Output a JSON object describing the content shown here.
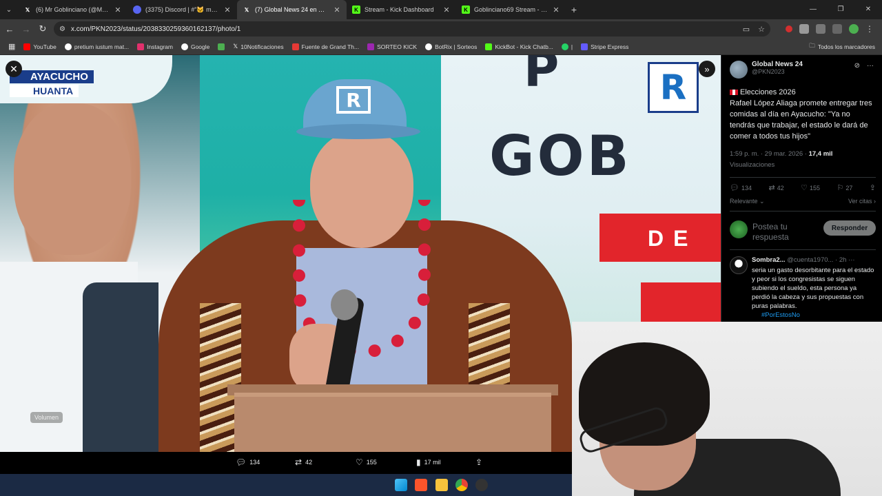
{
  "tabs": [
    {
      "title": "(6) Mr Goblinciano (@MGoblinciano",
      "active": false,
      "favicon": "x-icon"
    },
    {
      "title": "(3375) Discord | #”🐱 memes",
      "active": false,
      "favicon": "discord-icon"
    },
    {
      "title": "(7) Global News 24 en X: \"•e Ele",
      "active": true,
      "favicon": "x-icon"
    },
    {
      "title": "Stream - Kick Dashboard",
      "active": false,
      "favicon": "kick-icon"
    },
    {
      "title": "Goblinciano69 Stream - Watch",
      "active": false,
      "favicon": "kick-icon"
    }
  ],
  "address": {
    "url": "x.com/PKN2023/status/2038330259360162137/photo/1"
  },
  "bookmarks": [
    {
      "label": "YouTube",
      "color": "#ff0000"
    },
    {
      "label": "pretium iustum mat...",
      "color": "#ffffff"
    },
    {
      "label": "Instagram",
      "color": "#e1306c"
    },
    {
      "label": "Google",
      "color": "#4285f4"
    },
    {
      "label": "",
      "color": "#4caf50"
    },
    {
      "label": "10Notificaciones",
      "color": "#ffffff"
    },
    {
      "label": "Fuente de Grand Th...",
      "color": "#e53935"
    },
    {
      "label": "SORTEO KICK",
      "color": "#9c27b0"
    },
    {
      "label": "BotRix | Sorteos",
      "color": "#ffffff"
    },
    {
      "label": "KickBot - Kick Chatb...",
      "color": "#53fc18"
    },
    {
      "label": "|",
      "color": "#25d366"
    },
    {
      "label": "Stripe Express",
      "color": "#635bff"
    }
  ],
  "bookmarks_all": "Todos los marcadores",
  "photo": {
    "location1": "AYACUCHO",
    "location2": "HUANTA",
    "logo_letter": "R",
    "banner_big": "GOB",
    "banner_red": "DE",
    "volume_label": "Volumen"
  },
  "photo_stats": {
    "replies": "134",
    "reposts": "42",
    "likes": "155",
    "views": "17 mil"
  },
  "post": {
    "name": "Global News 24",
    "handle": "@PKN2023",
    "line1": "Elecciones 2026",
    "body": "Rafael López Aliaga promete entregar tres comidas al día en Ayacucho: \"Ya no tendrás que trabajar, el estado le dará de comer a todos tus hijos\"",
    "time": "1:59 p. m. · 29 mar. 2026 · ",
    "views_count": "17,4 mil",
    "views_label": "Visualizaciones",
    "replies": "134",
    "reposts": "42",
    "likes": "155",
    "bookmarks": "27",
    "sort": "Relevante",
    "quotes": "Ver citas"
  },
  "reply": {
    "placeholder": "Postea tu respuesta",
    "button": "Responder"
  },
  "comment": {
    "name": "Sombra2...",
    "handle": "@cuenta1970...",
    "time": "· 2h",
    "text": "seria un gasto desorbitante para el estado y peor si los congresistas se siguen subiendo el sueldo, esta persona ya perdió la cabeza y sus propuestas con puras palabras.",
    "hashtag": "#PorEstosNo"
  },
  "colors": {
    "accent": "#1d9bf0",
    "bg": "#000000",
    "muted": "#71767b"
  }
}
